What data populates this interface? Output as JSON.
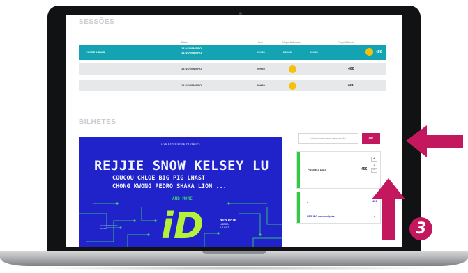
{
  "sessions": {
    "title": "SESSÕES",
    "columns": {
      "date": "Data",
      "time": "Hora",
      "availability": "Disponibilidade",
      "price": "Preço/Bilhete"
    },
    "rows": [
      {
        "name": "PASSE 2 DIAS",
        "date_line1": "13 NOVEMBRO",
        "date_line2": "14 NOVEMBRO",
        "time": "20H30",
        "avail": "20H30",
        "avail2": "20H30",
        "price": "45€",
        "selected": true
      },
      {
        "name": "",
        "date_line1": "13 NOVEMBRO",
        "time": "20H30",
        "price": "40€"
      },
      {
        "name": "",
        "date_line1": "14 NOVEMBRO",
        "time": "20H30",
        "price": "40€"
      }
    ],
    "availability_color": "#f4c20d",
    "selected_color": "#14a3b3"
  },
  "tickets": {
    "title": "BILHETES",
    "promo_placeholder": "CÓDIGO DESCONTO / PROMOÇÃO",
    "ok_label": "OK",
    "item_label": "PASSE 2 DIAS",
    "item_price": "45€",
    "qty": "1",
    "plus": "+",
    "minus": "−",
    "total_label": "-",
    "total_price": "45€",
    "insurance_link": "SEGURO ver condições",
    "remove": "×"
  },
  "poster": {
    "top_line": "LIVE EXPERIENCE PRESENTS",
    "headline": "REJJIE SNOW   KELSEY LU",
    "line2": "COUCOU CHLOE  BIG PIG  LHAST",
    "line3": "CHONG KWONG  PEDRO  SHAKA LION ...",
    "more": "AND MORE",
    "logo": "iD",
    "new_date": "NEW DATE",
    "new_date_detail": "LISBOA\n2-3 OUT",
    "small": "CONTEMPORARY\nSOUND"
  },
  "callout": {
    "step": "3",
    "color": "#c3185e"
  }
}
